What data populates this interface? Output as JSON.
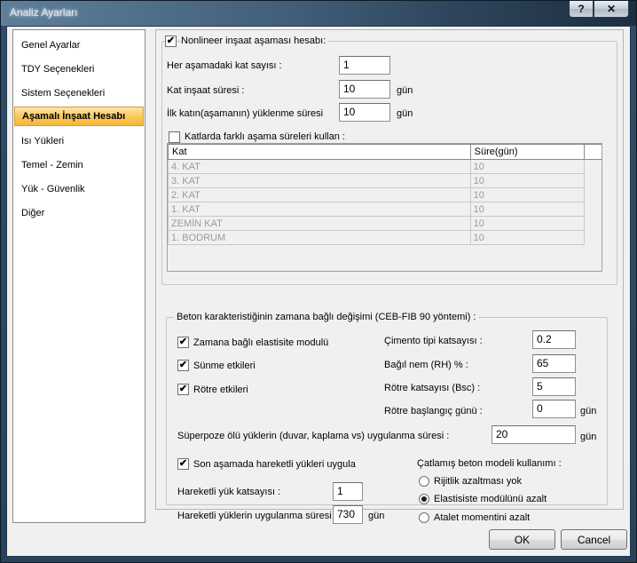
{
  "window": {
    "title": "Analiz Ayarları",
    "help": "?",
    "close": "✕"
  },
  "sidebar": {
    "items": [
      {
        "label": "Genel Ayarlar"
      },
      {
        "label": "TDY Seçenekleri"
      },
      {
        "label": "Sistem Seçenekleri"
      },
      {
        "label": "Aşamalı İnşaat Hesabı",
        "selected": true
      },
      {
        "label": "Isı Yükleri"
      },
      {
        "label": "Temel - Zemin"
      },
      {
        "label": "Yük - Güvenlik"
      },
      {
        "label": "Diğer"
      }
    ]
  },
  "nonlinear": {
    "checkbox_label": "Nonlineer inşaat aşaması hesabı:",
    "checked": true,
    "stage_floor_count_label": "Her aşamadaki kat sayısı  :",
    "stage_floor_count_value": "1",
    "floor_duration_label": "Kat inşaat süresi :",
    "floor_duration_value": "10",
    "floor_duration_unit": "gün",
    "first_load_label": "İlk katın(aşamanın) yüklenme süresi",
    "first_load_value": "10",
    "first_load_unit": "gün",
    "diff_durations_label": "Katlarda farklı aşama süreleri kullan :",
    "diff_durations_checked": false
  },
  "floor_table": {
    "headers": [
      "Kat",
      "Süre(gün)"
    ],
    "rows": [
      [
        "4. KAT",
        "10"
      ],
      [
        "3. KAT",
        "10"
      ],
      [
        "2. KAT",
        "10"
      ],
      [
        "1. KAT",
        "10"
      ],
      [
        "ZEMİN KAT",
        "10"
      ],
      [
        "1. BODRUM",
        "10"
      ]
    ]
  },
  "concrete": {
    "group_title": "Beton karakteristiğinin zamana bağlı değişimi (CEB-FIB 90 yöntemi) :",
    "elastic_label": "Zamana bağlı elastisite modulü",
    "creep_label": "Sünme etkileri",
    "shrinkage_label": "Rötre etkileri",
    "cement_label": "Çimento tipi katsayısı :",
    "cement_value": "0.2",
    "humidity_label": "Bağıl nem (RH) % :",
    "humidity_value": "65",
    "shrink_coef_label": "Rötre katsayısı (Bsc) :",
    "shrink_coef_value": "5",
    "shrink_start_label": "Rötre başlangıç günü :",
    "shrink_start_value": "0",
    "shrink_start_unit": "gün",
    "superpose_label": "Süperpoze ölü yüklerin (duvar, kaplama vs) uygulanma süresi :",
    "superpose_value": "20",
    "superpose_unit": "gün"
  },
  "moving_loads": {
    "last_stage_label": "Son aşamada hareketli yükleri uygula",
    "factor_label": "Hareketli yük katsayısı :",
    "factor_value": "1",
    "duration_label": "Hareketli yüklerin uygulanma süresi",
    "duration_value": "730",
    "duration_unit": "gün"
  },
  "cracked_model": {
    "label": "Çatlamış beton modeli kullanımı :",
    "options": [
      {
        "label": "Rijitlik azaltması yok",
        "selected": false
      },
      {
        "label": "Elastisiste modülünü azalt",
        "selected": true
      },
      {
        "label": "Atalet momentini azalt",
        "selected": false
      }
    ]
  },
  "buttons": {
    "ok": "OK",
    "cancel": "Cancel"
  }
}
